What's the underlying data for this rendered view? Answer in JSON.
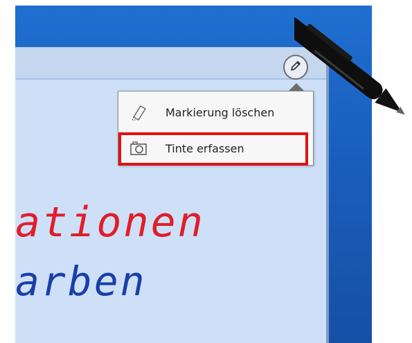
{
  "window": {
    "pen_button_label": ""
  },
  "menu": {
    "items": [
      {
        "label": "Markierung löschen",
        "icon": "eraser-icon"
      },
      {
        "label": "Tinte erfassen",
        "icon": "camera-icon"
      }
    ]
  },
  "ink": {
    "line1": "ationen",
    "line2": "arben"
  },
  "colors": {
    "desktop_blue": "#1a60bf",
    "window_bg": "#cde0f8",
    "highlight_red": "#e11212",
    "ink_red": "#e01e2a",
    "ink_blue": "#1a3fa8"
  }
}
